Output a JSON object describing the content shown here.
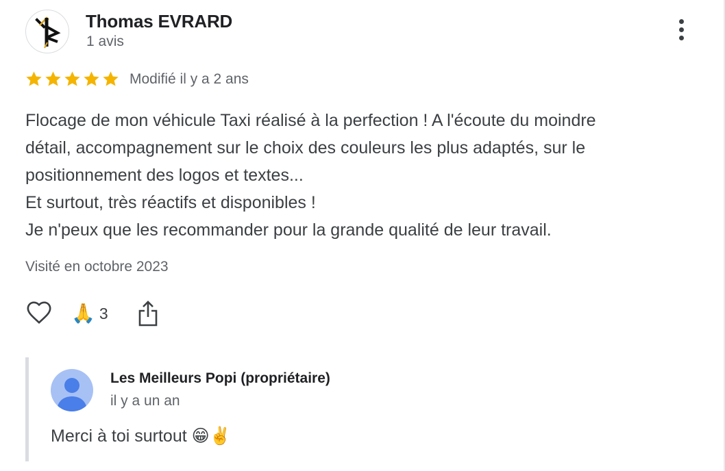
{
  "review": {
    "author": "Thomas EVRARD",
    "review_count": "1 avis",
    "rating": 5,
    "rating_max": 5,
    "star_color": "#f4b400",
    "modified": "Modifié il y a 2 ans",
    "text_lines": [
      "Flocage de mon véhicule Taxi réalisé à la perfection ! A l'écoute du moindre",
      "détail, accompagnement sur le choix des couleurs les plus adaptés, sur le",
      "positionnement des logos et textes...",
      "Et surtout, très réactifs et disponibles !",
      "Je n'peux que les recommander pour la grande qualité de leur travail."
    ],
    "visited": "Visité en octobre 2023",
    "icons": {
      "menu": "more-vert-icon",
      "like": "heart-icon",
      "share": "share-icon"
    },
    "reaction": {
      "emoji": "🙏",
      "count": "3"
    }
  },
  "reply": {
    "owner": "Les Meilleurs Popi (propriétaire)",
    "time": "il y a un an",
    "text": "Merci à toi surtout 😁✌️",
    "avatar_color": "#a7c1f5",
    "avatar_figure_color": "#4a7ee8"
  }
}
